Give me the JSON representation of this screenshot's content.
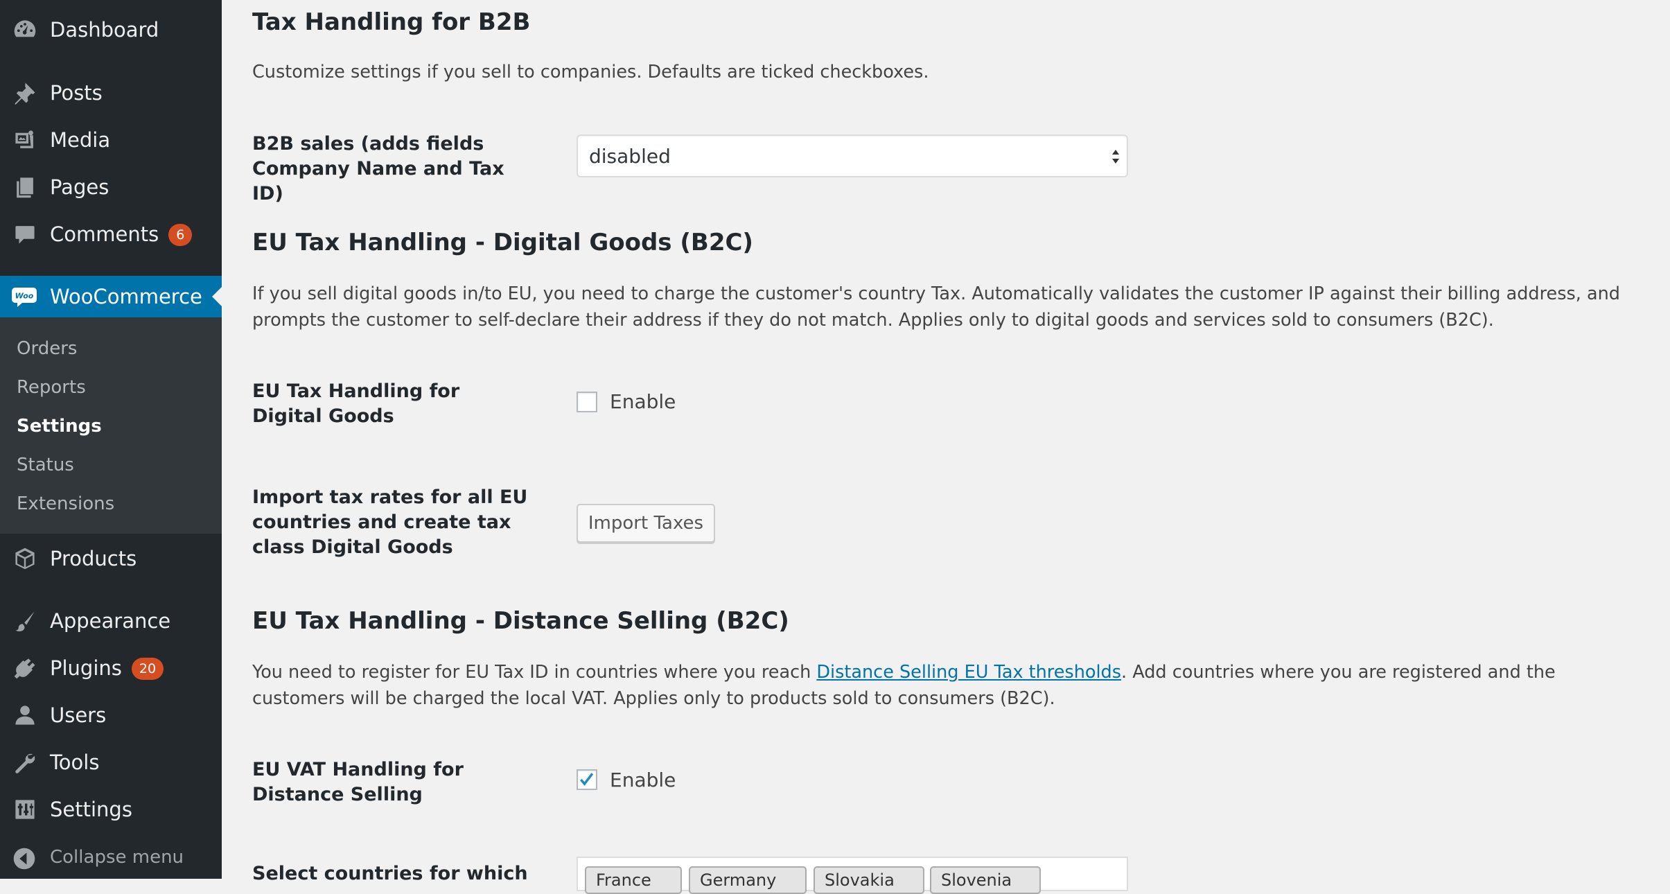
{
  "sidebar": {
    "items": [
      {
        "label": "Dashboard",
        "icon": "dashboard-icon"
      },
      {
        "label": "Posts",
        "icon": "pin-icon"
      },
      {
        "label": "Media",
        "icon": "media-icon"
      },
      {
        "label": "Pages",
        "icon": "pages-icon"
      },
      {
        "label": "Comments",
        "icon": "comments-icon",
        "badge": "6"
      },
      {
        "label": "WooCommerce",
        "icon": "woocommerce-icon",
        "active": true
      },
      {
        "label": "Products",
        "icon": "products-icon"
      },
      {
        "label": "Appearance",
        "icon": "appearance-icon"
      },
      {
        "label": "Plugins",
        "icon": "plugins-icon",
        "badge": "20"
      },
      {
        "label": "Users",
        "icon": "users-icon"
      },
      {
        "label": "Tools",
        "icon": "tools-icon"
      },
      {
        "label": "Settings",
        "icon": "settings-icon"
      }
    ],
    "submenu": [
      {
        "label": "Orders"
      },
      {
        "label": "Reports"
      },
      {
        "label": "Settings",
        "current": true
      },
      {
        "label": "Status"
      },
      {
        "label": "Extensions"
      }
    ],
    "woo_logo_text": "Woo",
    "collapse_label": "Collapse menu"
  },
  "main": {
    "b2b": {
      "heading": "Tax Handling for B2B",
      "description": "Customize settings if you sell to companies. Defaults are ticked checkboxes.",
      "field_label": "B2B sales (adds fields Company Name and Tax ID)",
      "select_value": "disabled"
    },
    "digital": {
      "heading": "EU Tax Handling - Digital Goods (B2C)",
      "description": "If you sell digital goods in/to EU, you need to charge the customer's country Tax. Automatically validates the customer IP against their billing address, and prompts the customer to self-declare their address if they do not match. Applies only to digital goods and services sold to consumers (B2C).",
      "enable_field_label": "EU Tax Handling for Digital Goods",
      "enable_label": "Enable",
      "enabled": false,
      "import_field_label": "Import tax rates for all EU countries and create tax class Digital Goods",
      "import_button": "Import Taxes"
    },
    "distance": {
      "heading": "EU Tax Handling - Distance Selling (B2C)",
      "description_before": "You need to register for EU Tax ID in countries where you reach ",
      "description_link": "Distance Selling EU Tax thresholds",
      "description_after": ". Add countries where you are registered and the customers will be charged the local VAT. Applies only to products sold to consumers (B2C).",
      "enable_field_label": "EU VAT Handling for Distance Selling",
      "enable_label": "Enable",
      "enabled": true,
      "countries_field_label": "Select countries for which",
      "selected_countries": [
        "France",
        "Germany",
        "Slovakia",
        "Slovenia"
      ]
    }
  },
  "colors": {
    "sidebar_bg": "#23282d",
    "submenu_bg": "#32373c",
    "accent": "#0073aa",
    "badge": "#d54e21",
    "page_bg": "#f1f1f1"
  }
}
